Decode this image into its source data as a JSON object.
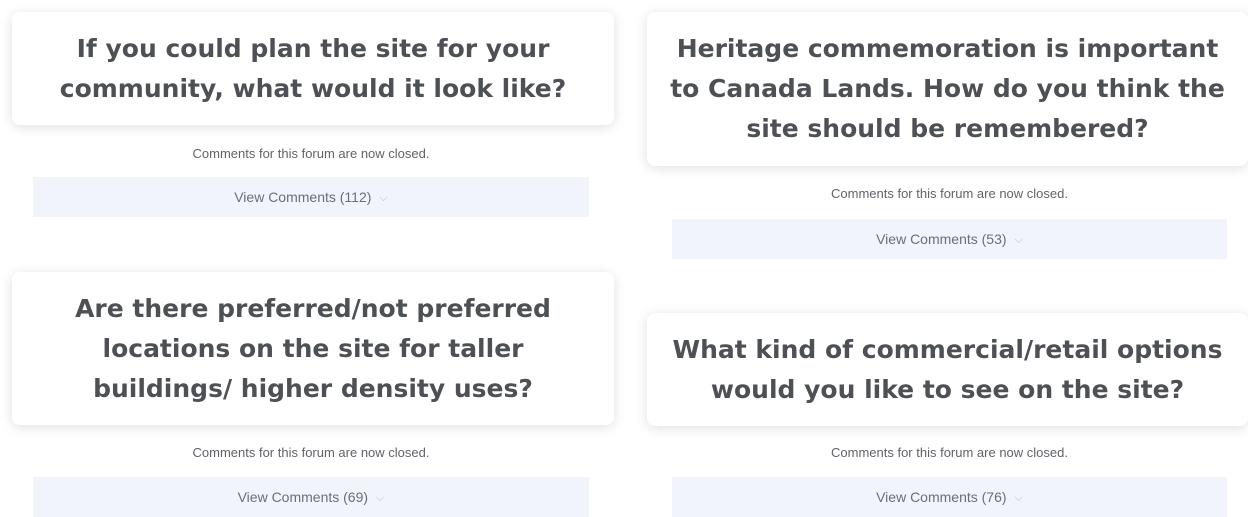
{
  "forums": [
    {
      "title": "If you could plan the site for your community, what would it look like?",
      "closed_note": "Comments for this forum are now closed.",
      "view_label": "View Comments (112)",
      "chevron_icon": "chevron-down-icon"
    },
    {
      "title": "Heritage commemoration is important to Canada Lands. How do you think the site should be remembered?",
      "closed_note": "Comments for this forum are now closed.",
      "view_label": "View Comments (53)",
      "chevron_icon": "chevron-down-icon"
    },
    {
      "title": "Are there preferred/not preferred locations on the site for taller buildings/ higher density uses?",
      "closed_note": "Comments for this forum are now closed.",
      "view_label": "View Comments (69)",
      "chevron_icon": "chevron-down-icon"
    },
    {
      "title": "What kind of commercial/retail options would you like to see on the site?",
      "closed_note": "Comments for this forum are now closed.",
      "view_label": "View Comments (76)",
      "chevron_icon": "chevron-down-icon"
    }
  ],
  "colors": {
    "title_text": "#4d5054",
    "button_bg": "#f1f5fb",
    "chevron": "#b4bcc8"
  }
}
